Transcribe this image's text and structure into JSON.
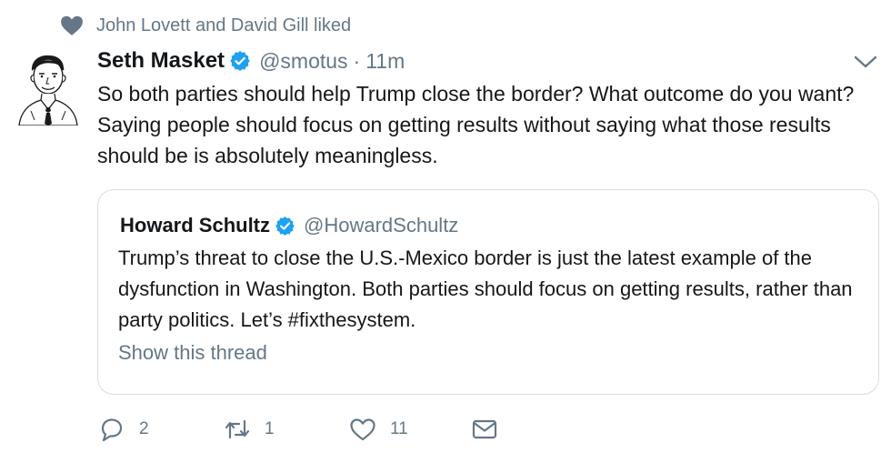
{
  "social_context": {
    "icon": "heart-icon",
    "text": "John Lovett and David Gill liked"
  },
  "tweet": {
    "author_name": "Seth Masket",
    "verified": true,
    "handle": "@smotus",
    "separator": "·",
    "time": "11m",
    "text": "So both parties should help Trump close the border? What outcome do you want? Saying people should focus on getting results without saying what those results should be is absolutely meaningless.",
    "menu_icon": "chevron-down-icon"
  },
  "quote": {
    "author_name": "Howard Schultz",
    "verified": true,
    "handle": "@HowardSchultz",
    "text": "Trump’s threat to close the U.S.-Mexico border is just the latest example of the dysfunction in Washington. Both parties should focus on getting results, rather than party politics. Let’s #fixthesystem.",
    "show_thread_label": "Show this thread"
  },
  "actions": {
    "reply_count": "2",
    "retweet_count": "1",
    "like_count": "11"
  },
  "colors": {
    "verified": "#1da1f2",
    "secondary_text": "#657786",
    "border": "#d5dde3"
  }
}
